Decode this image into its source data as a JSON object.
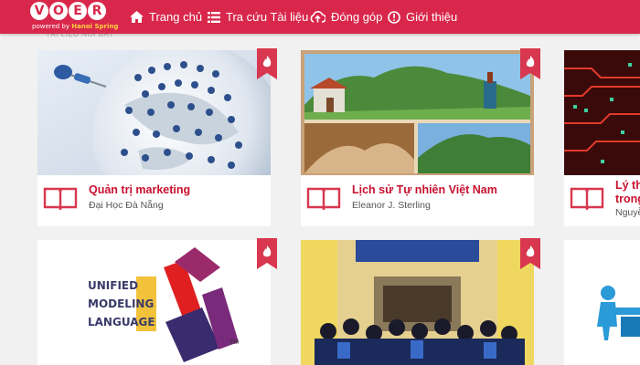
{
  "brand": {
    "logo_letters": [
      "V",
      "O",
      "E",
      "R"
    ],
    "tagline_prefix": "powered by",
    "tagline_name": "Hanoi Spring"
  },
  "nav": [
    {
      "label": "Trang chủ",
      "icon": "home-icon"
    },
    {
      "label": "Tra cứu Tài liệu",
      "icon": "list-icon"
    },
    {
      "label": "Đóng góp",
      "icon": "cloud-upload-icon"
    },
    {
      "label": "Giới thiệu",
      "icon": "info-icon"
    }
  ],
  "section_caption": "TÀI LIỆU NỔI BẬT",
  "cards": [
    {
      "title": "Quản trị marketing",
      "author": "Đại Học Đà Nẵng",
      "image": "globe-pushpins-image",
      "badge": "fire-icon"
    },
    {
      "title": "Lịch sử Tự nhiên Việt Nam",
      "author": "Eleanor J. Sterling",
      "image": "vietnam-landscape-collage",
      "badge": "fire-icon"
    },
    {
      "title": "Lý th",
      "title_line2": "trong",
      "author": "Nguyễ",
      "image": "digital-circuit-image",
      "badge": "fire-icon"
    },
    {
      "title": "",
      "author": "",
      "image": "uml-logo-image",
      "uml_lines": [
        "UNIFIED",
        "MODELING",
        "LANGUAGE"
      ],
      "badge": "fire-icon"
    },
    {
      "title": "",
      "author": "",
      "image": "graduation-photo",
      "badge": "fire-icon"
    },
    {
      "title": "",
      "author": "",
      "image": "3d-figure-image",
      "badge": ""
    }
  ],
  "colors": {
    "brand": "#d9274b",
    "title": "#c8102e",
    "badge": "#d8374f"
  }
}
